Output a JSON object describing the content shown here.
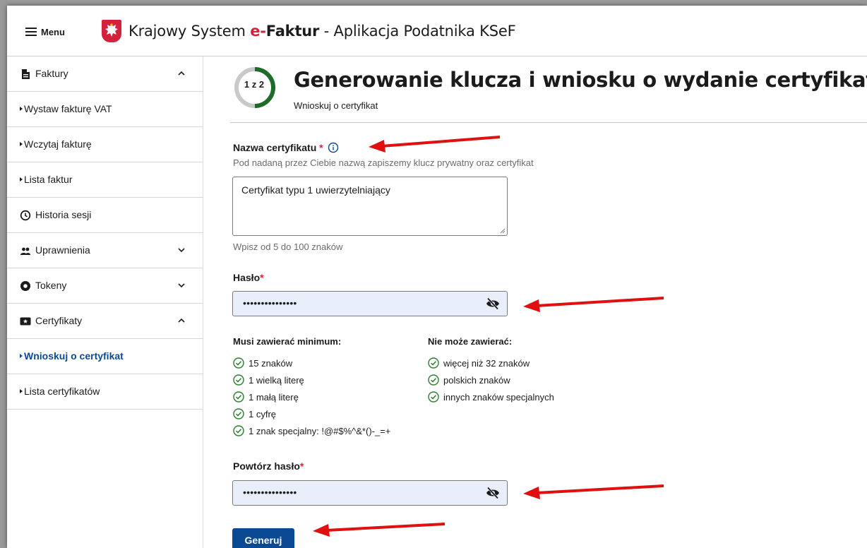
{
  "header": {
    "menu_label": "Menu",
    "title_prefix": "Krajowy System ",
    "title_brand_e": "e-",
    "title_brand_rest": "Faktur",
    "title_suffix": " - Aplikacja Podatnika KSeF"
  },
  "sidebar": {
    "items": [
      {
        "label": "Faktury",
        "icon": "document-icon",
        "chevron": "up"
      },
      {
        "label": "Wystaw fakturę VAT"
      },
      {
        "label": "Wczytaj fakturę"
      },
      {
        "label": "Lista faktur"
      },
      {
        "label": "Historia sesji",
        "icon": "clock-icon"
      },
      {
        "label": "Uprawnienia",
        "icon": "people-icon",
        "chevron": "down"
      },
      {
        "label": "Tokeny",
        "icon": "token-icon",
        "chevron": "down"
      },
      {
        "label": "Certyfikaty",
        "icon": "certificate-icon",
        "chevron": "up"
      },
      {
        "label": "Wnioskuj o certyfikat",
        "active": true
      },
      {
        "label": "Lista certyfikatów"
      }
    ]
  },
  "main": {
    "step": "1 z 2",
    "step_progress": 0.5,
    "title": "Generowanie klucza i wniosku o wydanie certyfikatu",
    "subtitle": "Wnioskuj o certyfikat",
    "cert_name": {
      "label": "Nazwa certyfikatu",
      "required_mark": "*",
      "hint": "Pod nadaną przez Ciebie nazwą zapiszemy klucz prywatny oraz certyfikat",
      "value": "Certyfikat typu 1 uwierzytelniający",
      "length_hint": "Wpisz od 5 do 100 znaków"
    },
    "password": {
      "label": "Hasło",
      "required_mark": "*",
      "masked_value": "•••••••••••••••"
    },
    "rules": {
      "must_head": "Musi zawierać minimum:",
      "must": [
        "15 znaków",
        "1 wielką literę",
        "1 małą literę",
        "1 cyfrę",
        "1 znak specjalny: !@#$%^&*()-_=+"
      ],
      "mustnot_head": "Nie może zawierać:",
      "mustnot": [
        "więcej niż 32 znaków",
        "polskich znaków",
        "innych znaków specjalnych"
      ]
    },
    "repeat_password": {
      "label": "Powtórz hasło",
      "required_mark": "*",
      "masked_value": "•••••••••••••••"
    },
    "generate_label": "Generuj"
  },
  "colors": {
    "accent": "#0b4a92",
    "required": "#d4213d",
    "check": "#2e7d32",
    "arrow": "#e01010",
    "step_done": "#1e6b2a"
  }
}
